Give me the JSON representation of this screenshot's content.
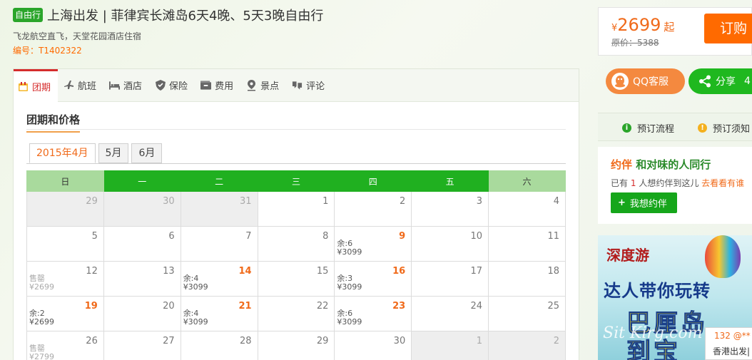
{
  "header": {
    "badge": "自由行",
    "title": "上海出发 | 菲律宾长滩岛6天4晚、5天3晚自由行",
    "subtitle": "飞龙航空直飞，天堂花园酒店住宿",
    "code": "编号：T1402322"
  },
  "price": {
    "currency": "¥",
    "amount": "2699",
    "suffix": "起",
    "original": "原价：5388",
    "book_label": "订购"
  },
  "service": {
    "qq_label": "QQ客服",
    "share_label": "分享",
    "share_count": "4"
  },
  "process": {
    "flow_label": "预订流程",
    "notice_label": "预订须知"
  },
  "buddy": {
    "title_mark": "约伴",
    "title_rest": "和对味的人同行",
    "line_pre": "已有",
    "count": "1",
    "line_post": "人想约伴到这儿",
    "link": "去看看有谁",
    "button": "我想约伴"
  },
  "tabs": [
    {
      "label": "团期",
      "icon": "calendar-icon"
    },
    {
      "label": "航班",
      "icon": "plane-icon"
    },
    {
      "label": "酒店",
      "icon": "bed-icon"
    },
    {
      "label": "保险",
      "icon": "shield-icon"
    },
    {
      "label": "费用",
      "icon": "wallet-icon"
    },
    {
      "label": "景点",
      "icon": "pin-icon"
    },
    {
      "label": "评论",
      "icon": "comment-icon"
    }
  ],
  "section_title": "团期和价格",
  "month_tabs": [
    "2015年4月",
    "5月",
    "6月"
  ],
  "weekdays": [
    "日",
    "一",
    "二",
    "三",
    "四",
    "五",
    "六"
  ],
  "calendar": [
    [
      {
        "d": "29",
        "o": true
      },
      {
        "d": "30",
        "o": true
      },
      {
        "d": "31",
        "o": true
      },
      {
        "d": "1"
      },
      {
        "d": "2"
      },
      {
        "d": "3"
      },
      {
        "d": "4"
      }
    ],
    [
      {
        "d": "5"
      },
      {
        "d": "6"
      },
      {
        "d": "7"
      },
      {
        "d": "8"
      },
      {
        "d": "9",
        "hot": true,
        "l1": "余:6",
        "l2": "¥3099"
      },
      {
        "d": "10"
      },
      {
        "d": "11"
      }
    ],
    [
      {
        "d": "12",
        "sold": true,
        "l1": "售罄",
        "l2": "¥2699"
      },
      {
        "d": "13"
      },
      {
        "d": "14",
        "hot": true,
        "l1": "余:4",
        "l2": "¥3099"
      },
      {
        "d": "15"
      },
      {
        "d": "16",
        "hot": true,
        "l1": "余:3",
        "l2": "¥3099"
      },
      {
        "d": "17"
      },
      {
        "d": "18"
      }
    ],
    [
      {
        "d": "19",
        "hot": true,
        "l1": "余:2",
        "l2": "¥2699"
      },
      {
        "d": "20"
      },
      {
        "d": "21",
        "hot": true,
        "l1": "余:4",
        "l2": "¥3099"
      },
      {
        "d": "22"
      },
      {
        "d": "23",
        "hot": true,
        "l1": "余:6",
        "l2": "¥3099"
      },
      {
        "d": "24"
      },
      {
        "d": "25"
      }
    ],
    [
      {
        "d": "26",
        "sold": true,
        "l1": "售罄",
        "l2": "¥2799"
      },
      {
        "d": "27"
      },
      {
        "d": "28"
      },
      {
        "d": "29"
      },
      {
        "d": "30"
      },
      {
        "d": "1",
        "o": true
      },
      {
        "d": "2",
        "o": true
      }
    ]
  ],
  "ad": {
    "brand": "深度游",
    "line1": "达人带你玩转",
    "line2": "巴厘岛",
    "line3": "到宝"
  },
  "chat": {
    "phone": "132 @**",
    "text": "香港出发|"
  },
  "watermark": "Sit Kirg.com",
  "colors": {
    "accent": "#ff6a00",
    "green": "#20b020",
    "red": "#d52c2c"
  }
}
